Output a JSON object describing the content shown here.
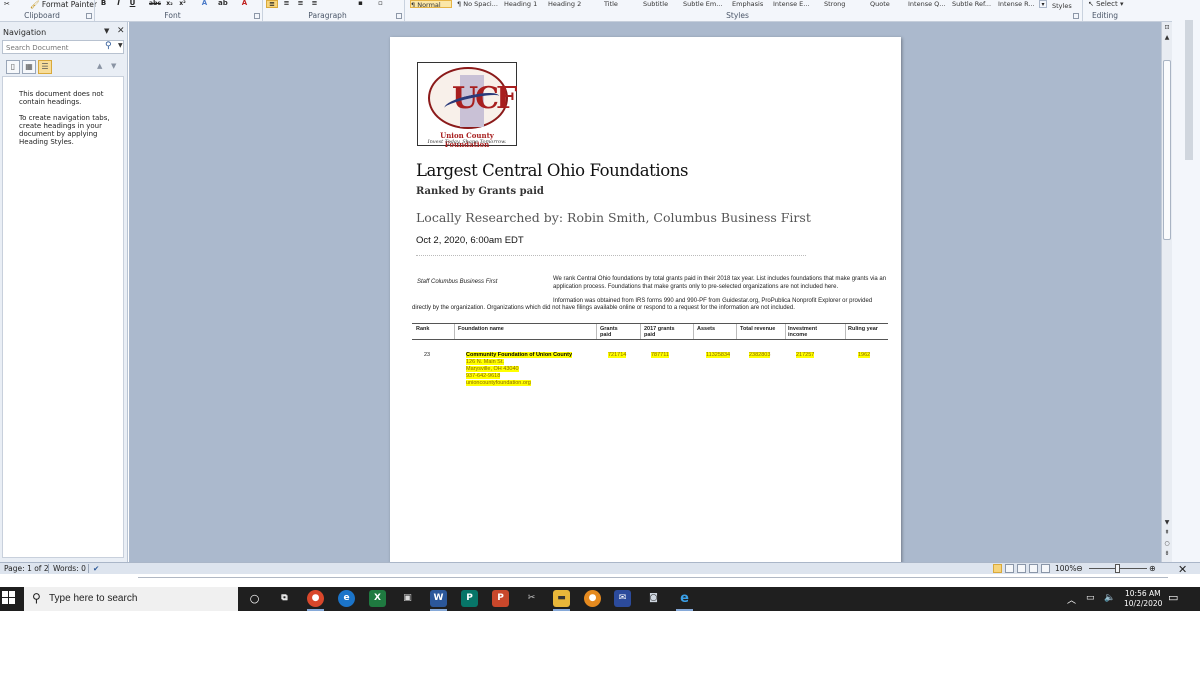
{
  "ribbon": {
    "clipboard_format_painter": "Format Painter",
    "group_clipboard": "Clipboard",
    "group_font": "Font",
    "group_paragraph": "Paragraph",
    "group_styles": "Styles",
    "group_editing": "Editing",
    "styles": [
      "¶ Normal",
      "¶ No Spaci...",
      "Heading 1",
      "Heading 2",
      "Title",
      "Subtitle",
      "Subtle Em...",
      "Emphasis",
      "Intense E...",
      "Strong",
      "Quote",
      "Intense Q...",
      "Subtle Ref...",
      "Intense R..."
    ],
    "change_styles": "Styles",
    "select_label": "Select",
    "font_buttons": [
      "B",
      "I",
      "U",
      "abc",
      "x₂",
      "x²"
    ]
  },
  "navigation": {
    "title": "Navigation",
    "search_placeholder": "Search Document",
    "message_1": "This document does not contain headings.",
    "message_2": "To create navigation tabs, create headings in your document by applying Heading Styles."
  },
  "document": {
    "logo_letters": "UCF",
    "logo_name": "Union County Foundation",
    "logo_tagline": "Invest Today. Shape Tomorrow.",
    "title": "Largest Central Ohio Foundations",
    "subtitle": "Ranked by Grants paid",
    "byline": "Locally Researched by: Robin Smith, Columbus Business First",
    "date": "Oct 2, 2020, 6:00am EDT",
    "staff": "Staff Columbus Business First",
    "intro_1": "We rank Central Ohio foundations by total grants paid in their 2018 tax year. List includes foundations that make grants via an application process. Foundations that make grants only to pre-selected organizations are not included here.",
    "intro_2": "Information was obtained from IRS forms 990 and 990-PF from Guidestar.org, ProPublica Nonprofit Explorer or provided",
    "intro_3": "directly by the organization. Organizations which did not have filings available online or respond to a request for the information are not included.",
    "table": {
      "headers": [
        "Rank",
        "Foundation name",
        "Grants paid",
        "2017 grants paid",
        "Assets",
        "Total revenue",
        "Investment income",
        "Ruling year"
      ],
      "row": {
        "rank": "23",
        "name": "Community Foundation of Union County",
        "address": "126 N. Main St.",
        "city": "Marysville, OH 43040",
        "phone": "937-642-9618",
        "web": "unioncountyfoundation.org",
        "grants_paid": "721714",
        "grants_2017": "787711",
        "assets": "11325834",
        "total_revenue": "2382803",
        "investment_income": "217257",
        "ruling_year": "1962"
      }
    }
  },
  "status": {
    "page": "Page: 1 of 2",
    "words": "Words: 0",
    "zoom": "100%"
  },
  "taskbar": {
    "search_placeholder": "Type here to search",
    "time": "10:56 AM",
    "date": "10/2/2020"
  },
  "colors": {
    "highlight": "#ffff00",
    "doc_background": "#abb9cd",
    "taskbar": "#1f1f1f"
  }
}
